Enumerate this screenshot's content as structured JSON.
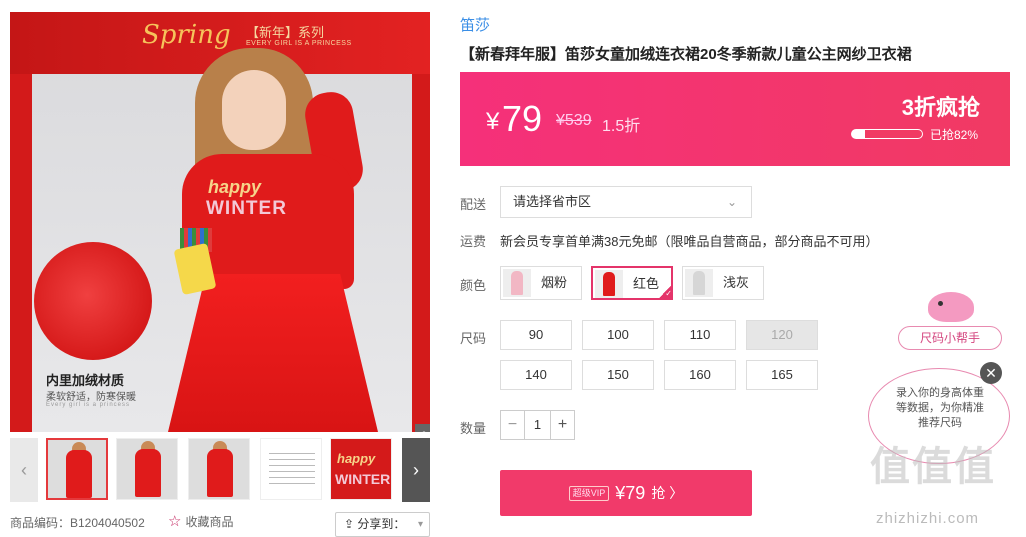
{
  "gallery": {
    "hero_title": "Spring",
    "hero_series": "【新年】系列",
    "hero_series_sub": "EVERY GIRL IS A PRINCESS",
    "print_line1": "happy",
    "print_line2": "WINTER",
    "caption": "内里加绒材质",
    "caption_sub": "柔软舒适，防寒保暖",
    "caption_en": "Every girl is a princess",
    "thumb_text1": "happy",
    "thumb_text2": "WINTER"
  },
  "footer_left": {
    "sku_label": "商品编码：B1204040502",
    "favorite_label": "收藏商品",
    "share_label": "分享到："
  },
  "product": {
    "brand": "笛莎",
    "title": "【新春拜年服】笛莎女童加绒连衣裙20冬季新款儿童公主网纱卫衣裙"
  },
  "price": {
    "currency": "¥",
    "current": "79",
    "original": "¥539",
    "discount": "1.5折",
    "flash_label": "3折疯抢",
    "sold_text": "已抢82%",
    "sold_fraction": 0.82
  },
  "delivery": {
    "label": "配送",
    "select_value": "请选择省市区"
  },
  "shipping": {
    "label": "运费",
    "text": "新会员专享首单满38元免邮（限唯品自营商品，部分商品不可用）"
  },
  "color": {
    "label": "颜色",
    "options": [
      {
        "name": "烟粉",
        "swatch": "#f2b7c4"
      },
      {
        "name": "红色",
        "swatch": "#e01b1b"
      },
      {
        "name": "浅灰",
        "swatch": "#d6d6d6"
      }
    ],
    "selected": "红色"
  },
  "size": {
    "label": "尺码",
    "options": [
      "90",
      "100",
      "110",
      "120",
      "140",
      "150",
      "160",
      "165"
    ],
    "disabled": [
      "120"
    ]
  },
  "quantity": {
    "label": "数量",
    "value": "1",
    "minus": "−",
    "plus": "+"
  },
  "buy_button": {
    "vip_badge": "超级VIP",
    "price": "¥79",
    "action": "抢 〉"
  },
  "size_helper": {
    "tag": "尺码小帮手",
    "text": "录入你的身高体重等数据，为你精准推荐尺码",
    "close": "✕"
  },
  "watermark": {
    "text": "值值值",
    "url": "zhizhizhi.com"
  },
  "colors": {
    "accent": "#f13a6a",
    "brand_link": "#3a8ee6"
  }
}
